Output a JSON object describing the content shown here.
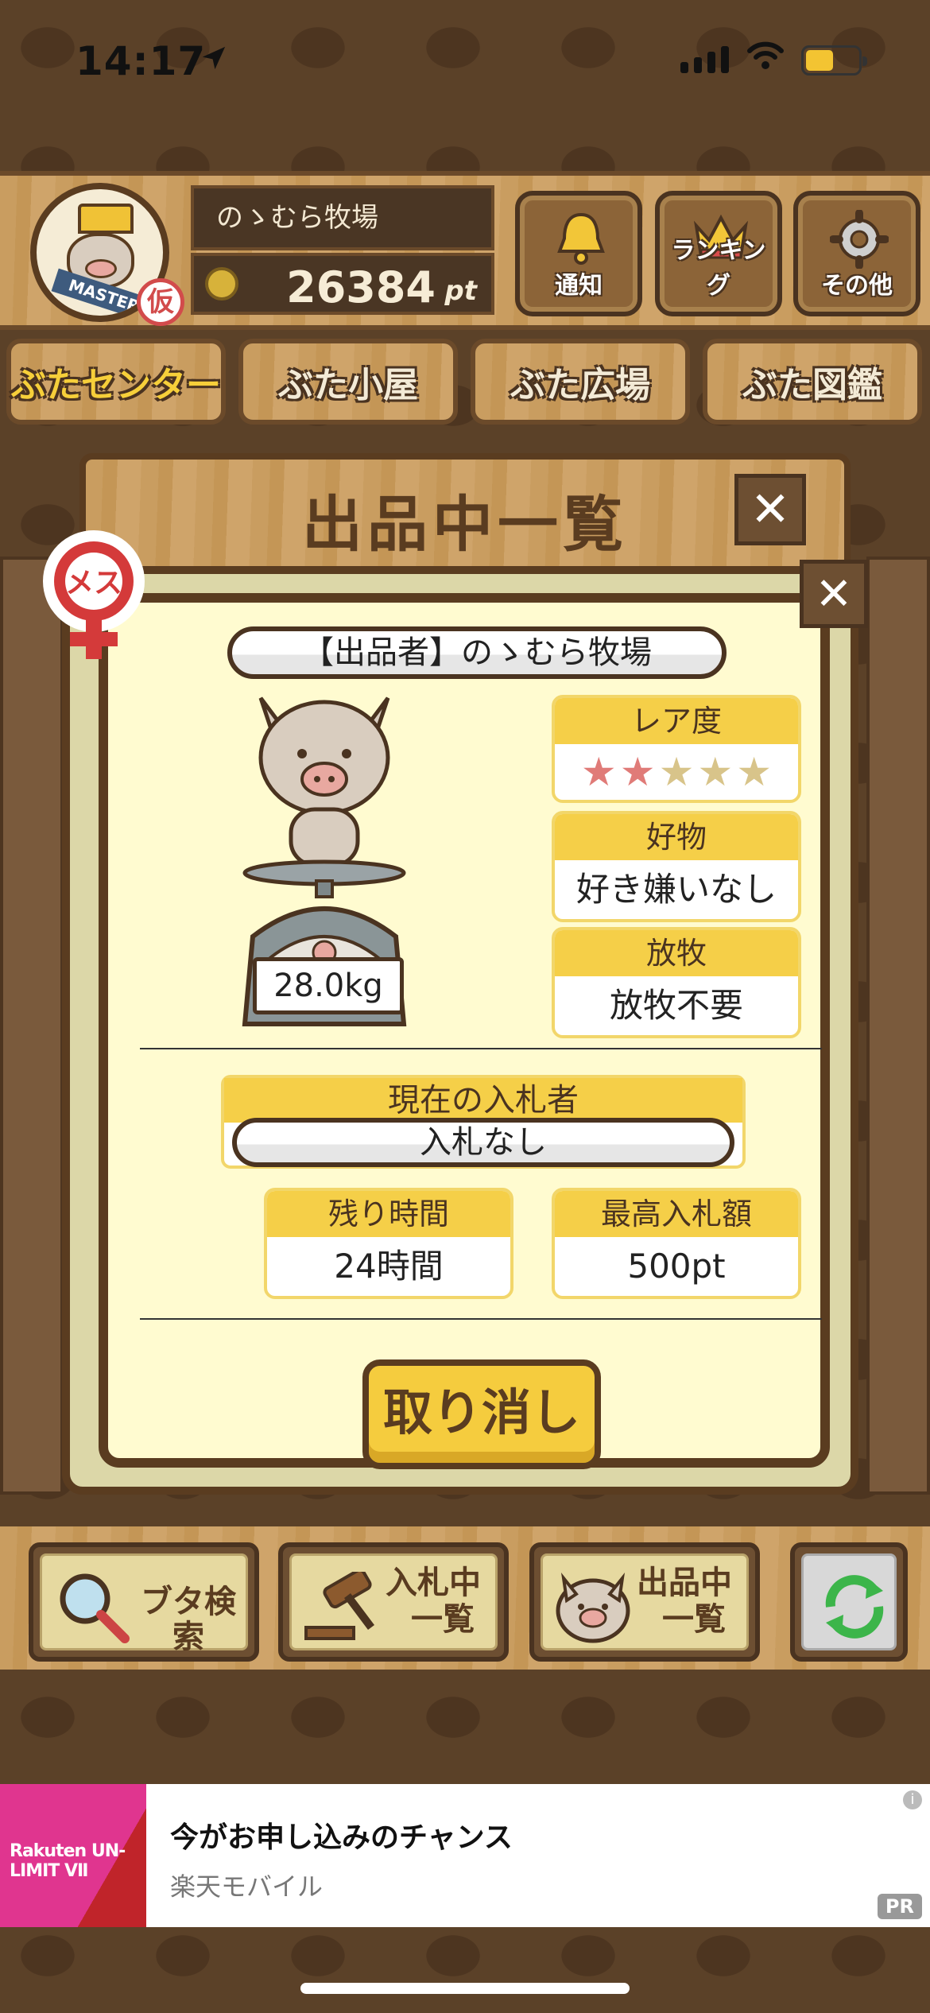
{
  "status_bar": {
    "time": "14:17"
  },
  "header": {
    "badge_text": "MASTER",
    "temp_badge": "仮",
    "farm_name": "のゝむら牧場",
    "points_value": "26384",
    "points_unit": "pt",
    "buttons": [
      {
        "label": "通知",
        "icon": "bell-icon"
      },
      {
        "label": "ランキング",
        "icon": "crown-icon"
      },
      {
        "label": "その他",
        "icon": "gear-icon"
      }
    ]
  },
  "nav_tabs": [
    {
      "label": "ぶたセンター",
      "active": true
    },
    {
      "label": "ぶた小屋",
      "active": false
    },
    {
      "label": "ぶた広場",
      "active": false
    },
    {
      "label": "ぶた図鑑",
      "active": false
    }
  ],
  "modal": {
    "title": "出品中一覧",
    "sex_badge": "メス",
    "seller": "【出品者】のゝむら牧場",
    "weight": "28.0kg",
    "rarity": {
      "label": "レア度",
      "stars_filled": 2,
      "stars_total": 5
    },
    "favorite": {
      "label": "好物",
      "value": "好き嫌いなし"
    },
    "grazing": {
      "label": "放牧",
      "value": "放牧不要"
    },
    "current_bidder": {
      "label": "現在の入札者",
      "value": "入札なし"
    },
    "remaining_time": {
      "label": "残り時間",
      "value": "24時間"
    },
    "highest_bid": {
      "label": "最高入札額",
      "value": "500pt"
    },
    "cancel_label": "取り消し"
  },
  "toolbar": {
    "search_label": "ブタ検索",
    "bidding_label_1": "入札中",
    "bidding_label_2": "一覧",
    "listing_label_1": "出品中",
    "listing_label_2": "一覧"
  },
  "ad": {
    "logo_text": "Rakuten UN-LIMIT Ⅶ",
    "title": "今がお申し込みのチャンス",
    "subtitle": "楽天モバイル",
    "pr_label": "PR",
    "info_label": "i"
  },
  "colors": {
    "accent_yellow": "#f5cf48",
    "wood_dark": "#5a3c20",
    "star_pink": "#e07b78",
    "star_tan": "#d8c48a"
  }
}
